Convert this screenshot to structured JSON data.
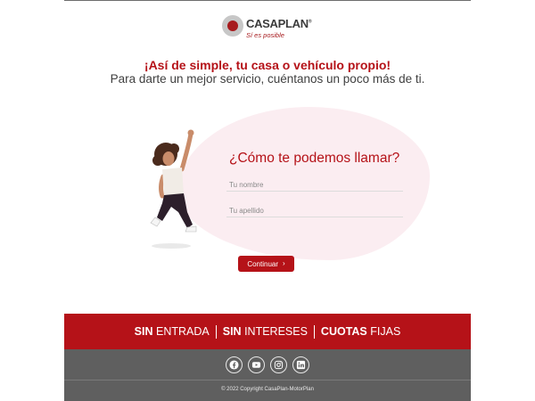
{
  "logo": {
    "brand": "CASAPLAN",
    "registered": "®",
    "tagline": "Sí es posible"
  },
  "hero": {
    "headline": "¡Así de simple, tu casa o vehículo propio!",
    "subheadline": "Para darte un mejor servicio, cuéntanos un poco más de ti."
  },
  "form": {
    "question": "¿Cómo te podemos llamar?",
    "first_name_placeholder": "Tu nombre",
    "last_name_placeholder": "Tu apellido",
    "submit_label": "Continuar",
    "submit_icon": "chevron-right-icon"
  },
  "band": {
    "item1_bold": "SIN",
    "item1_rest": "ENTRADA",
    "item2_bold": "SIN",
    "item2_rest": "INTERESES",
    "item3_bold": "CUOTAS",
    "item3_rest": "FIJAS"
  },
  "footer": {
    "socials": [
      "facebook-icon",
      "youtube-icon",
      "instagram-icon",
      "linkedin-icon"
    ],
    "copyright": "© 2022 Copyright CasaPlan-MotorPlan"
  },
  "colors": {
    "brand_red": "#b51218",
    "footer_gray": "#5f5f5f",
    "blob_pink": "#fbedf1",
    "text_dark": "#3f3f3f"
  }
}
